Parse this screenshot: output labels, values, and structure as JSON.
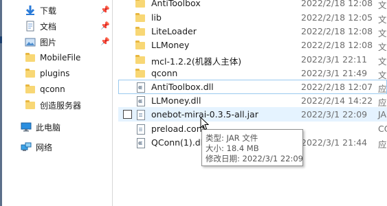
{
  "nav": {
    "quick_access": [
      {
        "label": "下载",
        "icon": "download-arrow-icon",
        "pinned": true
      },
      {
        "label": "文档",
        "icon": "document-icon",
        "pinned": true
      },
      {
        "label": "图片",
        "icon": "pictures-icon",
        "pinned": true
      },
      {
        "label": "MobileFile",
        "icon": "folder-icon",
        "pinned": false
      },
      {
        "label": "plugins",
        "icon": "folder-icon",
        "pinned": false
      },
      {
        "label": "qconn",
        "icon": "folder-icon",
        "pinned": false
      },
      {
        "label": "创造服务器",
        "icon": "folder-icon",
        "pinned": false
      }
    ],
    "this_pc": "此电脑",
    "network": "网络",
    "pin_icon": "pin-icon"
  },
  "files": {
    "rows": [
      {
        "name": "AntiToolbox",
        "date": "2022/2/18 12:08",
        "type": "文件",
        "icon": "folder-icon"
      },
      {
        "name": "lib",
        "date": "2022/2/18 12:05",
        "type": "文件",
        "icon": "folder-icon"
      },
      {
        "name": "LiteLoader",
        "date": "2022/2/18 12:08",
        "type": "文件",
        "icon": "folder-icon"
      },
      {
        "name": "LLMoney",
        "date": "2022/2/18 12:08",
        "type": "文件",
        "icon": "folder-icon"
      },
      {
        "name": "mcl-1.2.2(机器人主体)",
        "date": "2022/3/1 22:11",
        "type": "文件",
        "icon": "folder-icon"
      },
      {
        "name": "qconn",
        "date": "2022/3/1 21:49",
        "type": "文件",
        "icon": "folder-icon"
      },
      {
        "name": "AntiToolbox.dll",
        "date": "2022/2/18 12:07",
        "type": "应用",
        "icon": "dll-file-icon"
      },
      {
        "name": "LLMoney.dll",
        "date": "2022/2/14 14:22",
        "type": "应用",
        "icon": "dll-file-icon"
      },
      {
        "name": "onebot-mirai-0.3.5-all.jar",
        "date": "2022/3/1 22:09",
        "type": "JAR",
        "icon": "jar-file-icon"
      },
      {
        "name": "preload.conf",
        "date": "",
        "type": "CO",
        "icon": "file-icon"
      },
      {
        "name": "QConn(1).dll",
        "date": "2022/3/1 21:44",
        "type": "应用",
        "icon": "dll-file-icon"
      }
    ]
  },
  "tooltip": {
    "type_line": "类型: JAR 文件",
    "size_line": "大小: 18.4 MB",
    "modified_line": "修改日期: 2022/3/1 22:09"
  },
  "colors": {
    "folder": "#f8d775",
    "hover": "#e5f3ff",
    "focus_border": "#99c9ef",
    "secondary_text": "#6d6d6d"
  }
}
